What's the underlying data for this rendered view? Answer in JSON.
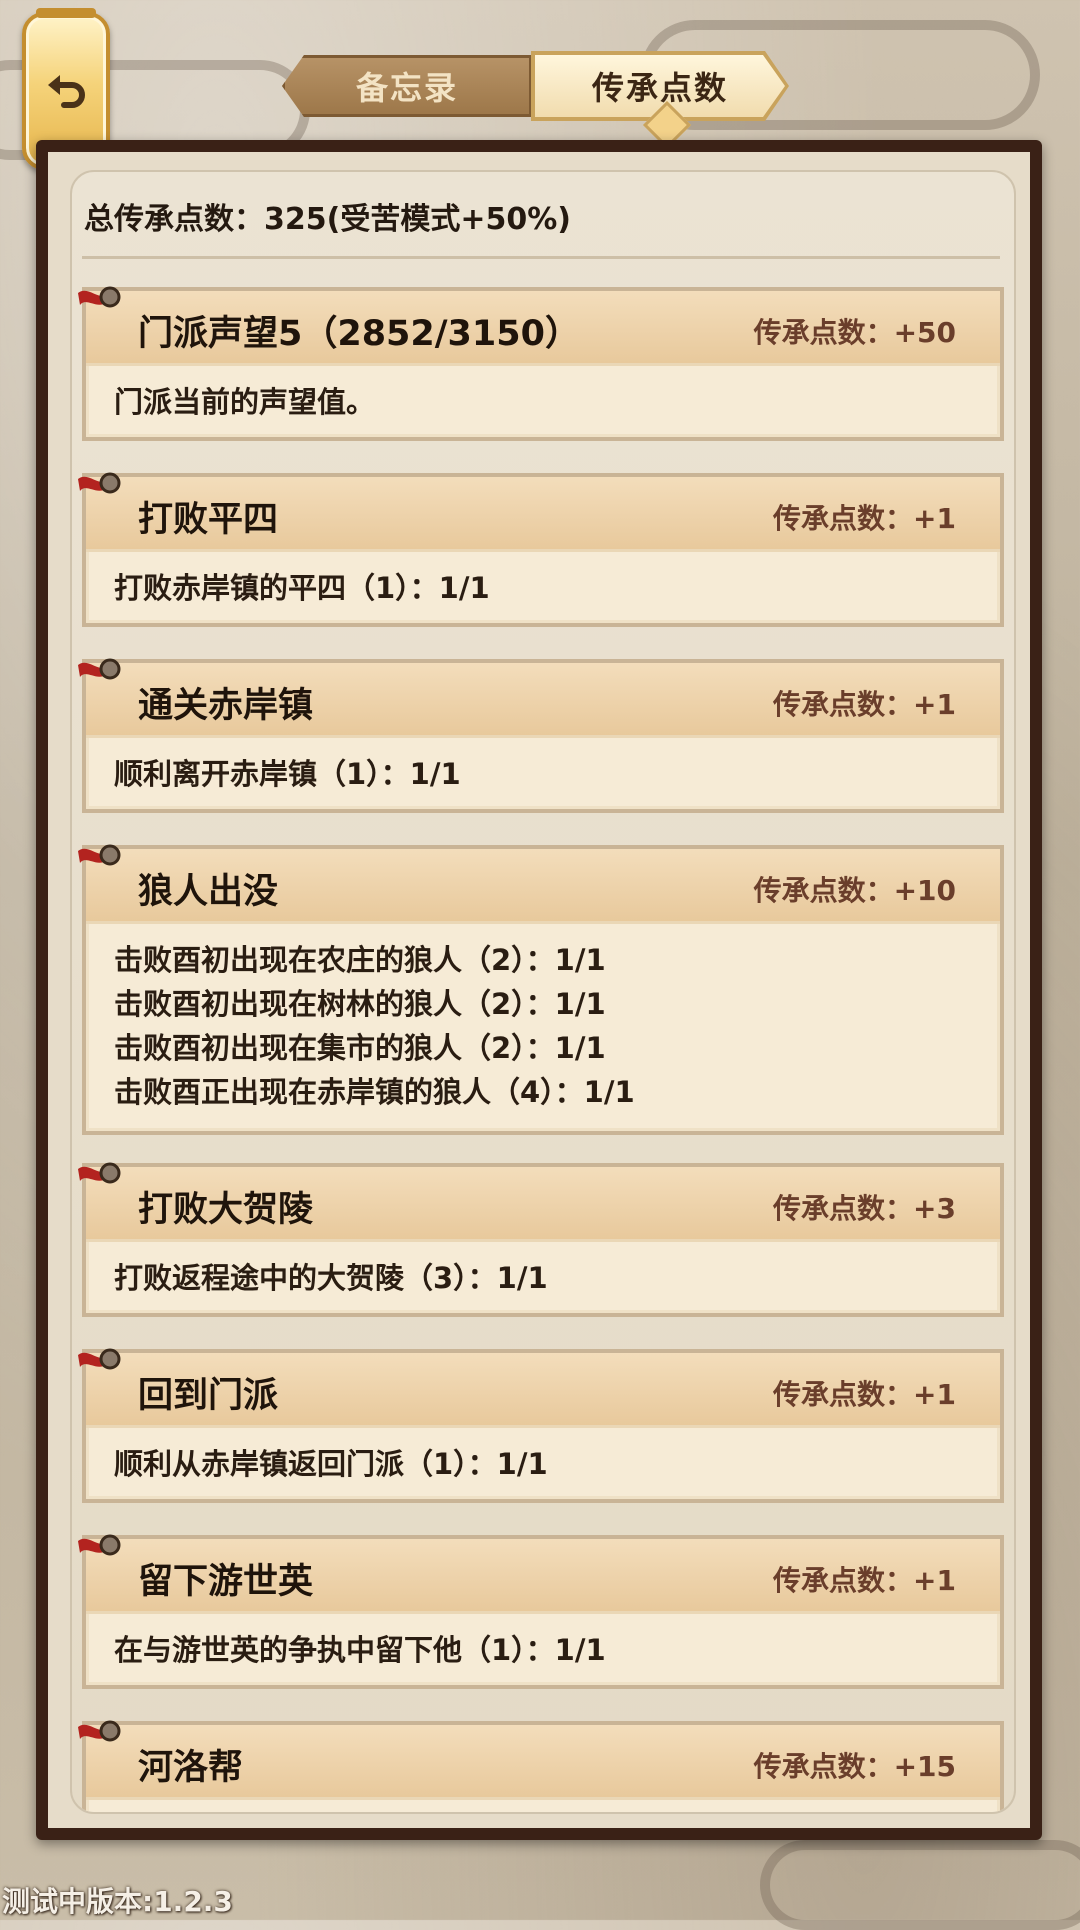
{
  "tabs": [
    {
      "label": "备忘录",
      "active": false
    },
    {
      "label": "传承点数",
      "active": true
    }
  ],
  "total_text": "总传承点数：325(受苦模式+50%)",
  "cards": [
    {
      "title": "门派声望5（2852/3150）",
      "points": "传承点数：+50",
      "lines": [
        "门派当前的声望值。"
      ]
    },
    {
      "title": "打败平四",
      "points": "传承点数：+1",
      "lines": [
        "打败赤岸镇的平四（1）：1/1"
      ]
    },
    {
      "title": "通关赤岸镇",
      "points": "传承点数：+1",
      "lines": [
        "顺利离开赤岸镇（1）：1/1"
      ]
    },
    {
      "title": "狼人出没",
      "points": "传承点数：+10",
      "lines": [
        "击败酉初出现在农庄的狼人（2）：1/1",
        "击败酉初出现在树林的狼人（2）：1/1",
        "击败酉初出现在集市的狼人（2）：1/1",
        "击败酉正出现在赤岸镇的狼人（4）：1/1"
      ]
    },
    {
      "title": "打败大贺陵",
      "points": "传承点数：+3",
      "lines": [
        "打败返程途中的大贺陵（3）：1/1"
      ]
    },
    {
      "title": "回到门派",
      "points": "传承点数：+1",
      "lines": [
        "顺利从赤岸镇返回门派（1）：1/1"
      ]
    },
    {
      "title": "留下游世英",
      "points": "传承点数：+1",
      "lines": [
        "在与游世英的争执中留下他（1）：1/1"
      ]
    },
    {
      "title": "河洛帮",
      "points": "传承点数：+15",
      "lines": []
    }
  ],
  "version": "测试中版本:1.2.3",
  "colors": {
    "accent": "#c48e2f",
    "frame": "#3a2116",
    "card_header": "#e8c99c",
    "points_text": "#6a3e2b"
  },
  "icons": {
    "back": "back-arrow-icon",
    "card": "ribbon-icon"
  }
}
